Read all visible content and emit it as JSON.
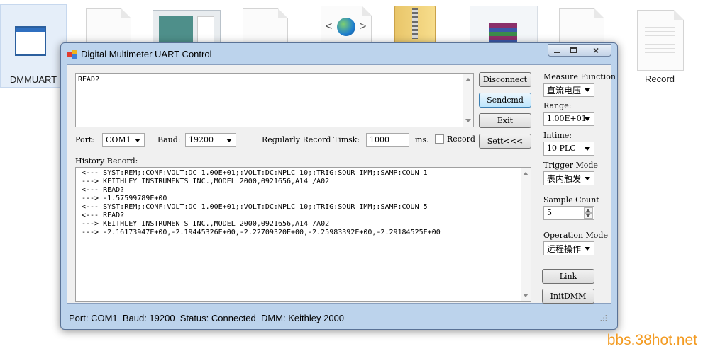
{
  "desktop": {
    "icons": [
      {
        "label": "DMMUART"
      },
      {
        "label": "Record"
      }
    ],
    "watermark": "bbs.38hot.net"
  },
  "window": {
    "title": "Digital Multimeter UART Control",
    "command_text": "READ?",
    "buttons": {
      "disconnect": "Disconnect",
      "sendcmd": "Sendcmd",
      "exit": "Exit",
      "sett": "Sett<<<",
      "link": "Link",
      "initdmm": "InitDMM"
    },
    "port": {
      "label": "Port:",
      "value": "COM1"
    },
    "baud": {
      "label": "Baud:",
      "value": "19200"
    },
    "record_interval": {
      "label": "Regularly Record Timsk:",
      "value": "1000",
      "unit": "ms."
    },
    "record_checkbox": {
      "label": "Record",
      "checked": false
    },
    "history": {
      "label": "History Record:",
      "lines": [
        "<--- SYST:REM;:CONF:VOLT:DC 1.00E+01;:VOLT:DC:NPLC 10;:TRIG:SOUR IMM;:SAMP:COUN 1",
        "---> KEITHLEY INSTRUMENTS INC.,MODEL 2000,0921656,A14  /A02",
        "<--- READ?",
        "---> -1.57599789E+00",
        "<--- SYST:REM;:CONF:VOLT:DC 1.00E+01;:VOLT:DC:NPLC 10;:TRIG:SOUR IMM;:SAMP:COUN 5",
        "<--- READ?",
        "---> KEITHLEY INSTRUMENTS INC.,MODEL 2000,0921656,A14  /A02",
        "---> -2.16173947E+00,-2.19445326E+00,-2.22709320E+00,-2.25983392E+00,-2.29184525E+00"
      ]
    },
    "side_panel": {
      "measure_function": {
        "label": "Measure Function",
        "value": "直流电压"
      },
      "range": {
        "label": "Range:",
        "value": "1.00E+01"
      },
      "intime": {
        "label": "Intime:",
        "value": "10 PLC"
      },
      "trigger_mode": {
        "label": "Trigger Mode",
        "value": "表内触发"
      },
      "sample_count": {
        "label": "Sample Count",
        "value": "5"
      },
      "operation_mode": {
        "label": "Operation Mode",
        "value": "远程操作"
      }
    },
    "status_bar": {
      "text": "Port: COM1  Baud: 19200  Status: Connected  DMM: Keithley 2000"
    }
  }
}
